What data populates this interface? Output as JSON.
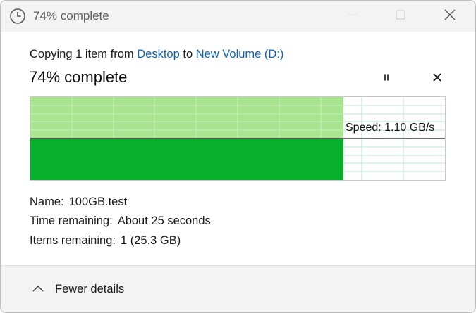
{
  "window": {
    "title": "74% complete",
    "icon": "clock-icon"
  },
  "header": {
    "copy_prefix": "Copying 1 item from",
    "source": "Desktop",
    "connector": "to",
    "destination": "New Volume (D:)",
    "status": "74% complete"
  },
  "progress": {
    "percent": 74,
    "speed_label": "Speed: 1.10 GB/s"
  },
  "details": {
    "name_label": "Name:",
    "name_value": "100GB.test",
    "time_label": "Time remaining:",
    "time_value": "About 25 seconds",
    "items_label": "Items remaining:",
    "items_value": "1 (25.3 GB)"
  },
  "footer": {
    "toggle_label": "Fewer details"
  },
  "colors": {
    "accent_link": "#0f62b4",
    "fill_light": "#a8e38f",
    "fill_dark": "#06b02a",
    "grid": "#bfe6cf"
  }
}
